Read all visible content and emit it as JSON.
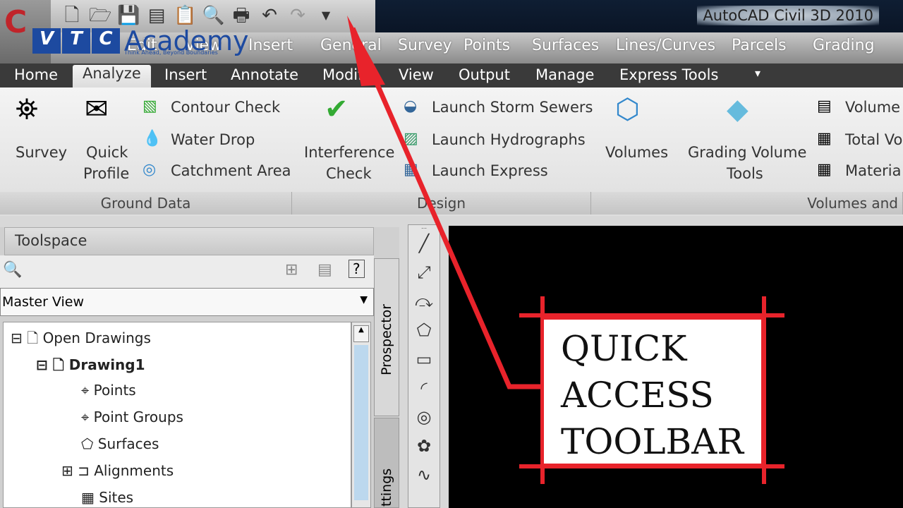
{
  "app": {
    "title": "AutoCAD Civil 3D 2010",
    "app_button_icon": "autocad-logo"
  },
  "quick_access_icons": [
    "new-icon",
    "open-icon",
    "save-icon",
    "saveas-icon",
    "paste-icon",
    "zoom-icon",
    "plot-icon",
    "undo-icon",
    "redo-icon",
    "customize-dropdown-icon"
  ],
  "logo": {
    "letters": [
      "V",
      "T",
      "C"
    ],
    "name": "Academy",
    "tagline": "Think Ahead, Beyond Boundaries"
  },
  "menu": [
    "Edit",
    "View",
    "Insert",
    "General",
    "Survey",
    "Points",
    "Surfaces",
    "Lines/Curves",
    "Parcels",
    "Grading"
  ],
  "tabs": [
    "Home",
    "Analyze",
    "Insert",
    "Annotate",
    "Modify",
    "View",
    "Output",
    "Manage",
    "Express Tools"
  ],
  "active_tab": "Analyze",
  "ribbon": {
    "ground_data": {
      "label": "Ground Data",
      "survey": "Survey",
      "quick": "Quick",
      "profile": "Profile",
      "contour": "Contour Check",
      "water": "Water Drop",
      "catchment": "Catchment Area"
    },
    "design": {
      "label": "Design",
      "interference1": "Interference",
      "interference2": "Check",
      "storm": "Launch Storm Sewers",
      "hydro": "Launch Hydrographs",
      "express": "Launch Express"
    },
    "volumes": {
      "label": "Volumes and",
      "volumes": "Volumes",
      "grading1": "Grading Volume",
      "grading2": "Tools",
      "vol": "Volume",
      "total": "Total Vo",
      "material": "Materia"
    }
  },
  "toolspace": {
    "title": "Toolspace",
    "view": "Master View",
    "tabs": [
      "Prospector",
      "ttings"
    ],
    "tree": [
      "Open Drawings",
      "Drawing1",
      "Points",
      "Point Groups",
      "Surfaces",
      "Alignments",
      "Sites"
    ]
  },
  "callout": {
    "lines": [
      "QUICK",
      "ACCESS",
      "TOOLBAR"
    ],
    "color": "#e8232b"
  }
}
